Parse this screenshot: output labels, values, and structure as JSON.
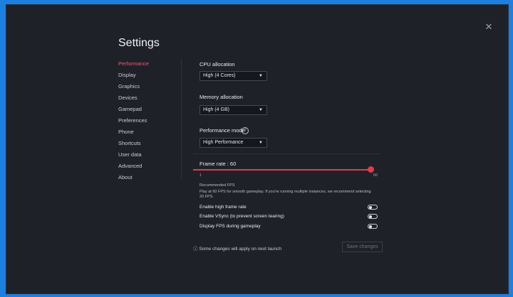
{
  "window": {
    "close_glyph": "✕"
  },
  "settings": {
    "title": "Settings"
  },
  "nav": {
    "items": [
      "Performance",
      "Display",
      "Graphics",
      "Devices",
      "Gamepad",
      "Preferences",
      "Phone",
      "Shortcuts",
      "User data",
      "Advanced",
      "About"
    ],
    "active_index": 0,
    "active_color": "#f15867"
  },
  "performance": {
    "cpu": {
      "label": "CPU allocation",
      "value": "High (4 Cores)"
    },
    "memory": {
      "label": "Memory allocation",
      "value": "High (4 GB)"
    },
    "mode": {
      "label": "Performance mode",
      "help_glyph": "?",
      "value": "High Performance"
    },
    "frame_rate": {
      "label": "Frame rate : 60",
      "min_label": "1",
      "max_label": "60",
      "value": 60,
      "min": 1,
      "max": 60,
      "accent": "#e53a4b"
    },
    "recommended": {
      "title": "Recommended FPS",
      "text_line1": "Play at 60 FPS for smooth gameplay. If you're running multiple instances, we recommend selecting",
      "text_line2": "20 FPS."
    },
    "toggles": [
      {
        "label": "Enable high frame rate",
        "on": false
      },
      {
        "label": "Enable VSync (to prevent screen tearing)",
        "on": false
      },
      {
        "label": "Display FPS during gameplay",
        "on": false
      }
    ]
  },
  "footer": {
    "info_icon": "ⓘ",
    "info_text": "Some changes will apply on next launch",
    "save_label": "Save changes"
  },
  "caret_glyph": "▼"
}
